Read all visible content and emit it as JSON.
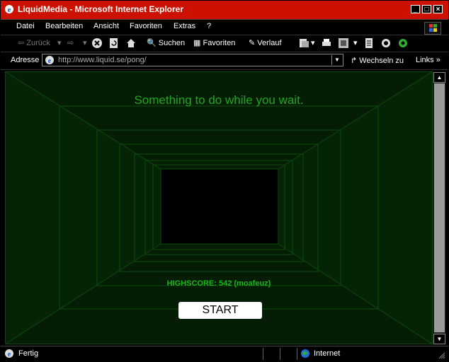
{
  "window": {
    "title": "LiquidMedia - Microsoft Internet Explorer"
  },
  "menu": [
    {
      "label": "Datei"
    },
    {
      "label": "Bearbeiten"
    },
    {
      "label": "Ansicht"
    },
    {
      "label": "Favoriten"
    },
    {
      "label": "Extras"
    },
    {
      "label": "?"
    }
  ],
  "toolbar": {
    "back_label": "Zurück",
    "search_label": "Suchen",
    "favorites_label": "Favoriten",
    "history_label": "Verlauf"
  },
  "address": {
    "label": "Adresse",
    "url": "http://www.liquid.se/pong/",
    "go_label": "Wechseln zu",
    "links_label": "Links"
  },
  "page": {
    "message": "Something to do while you wait.",
    "highscore": "HIGHSCORE: 542 (moafeuz)",
    "start_label": "START"
  },
  "status": {
    "text": "Fertig",
    "zone": "Internet"
  },
  "colors": {
    "titlebar": "#cc1100",
    "tunnel_green": "#1fa81f"
  }
}
